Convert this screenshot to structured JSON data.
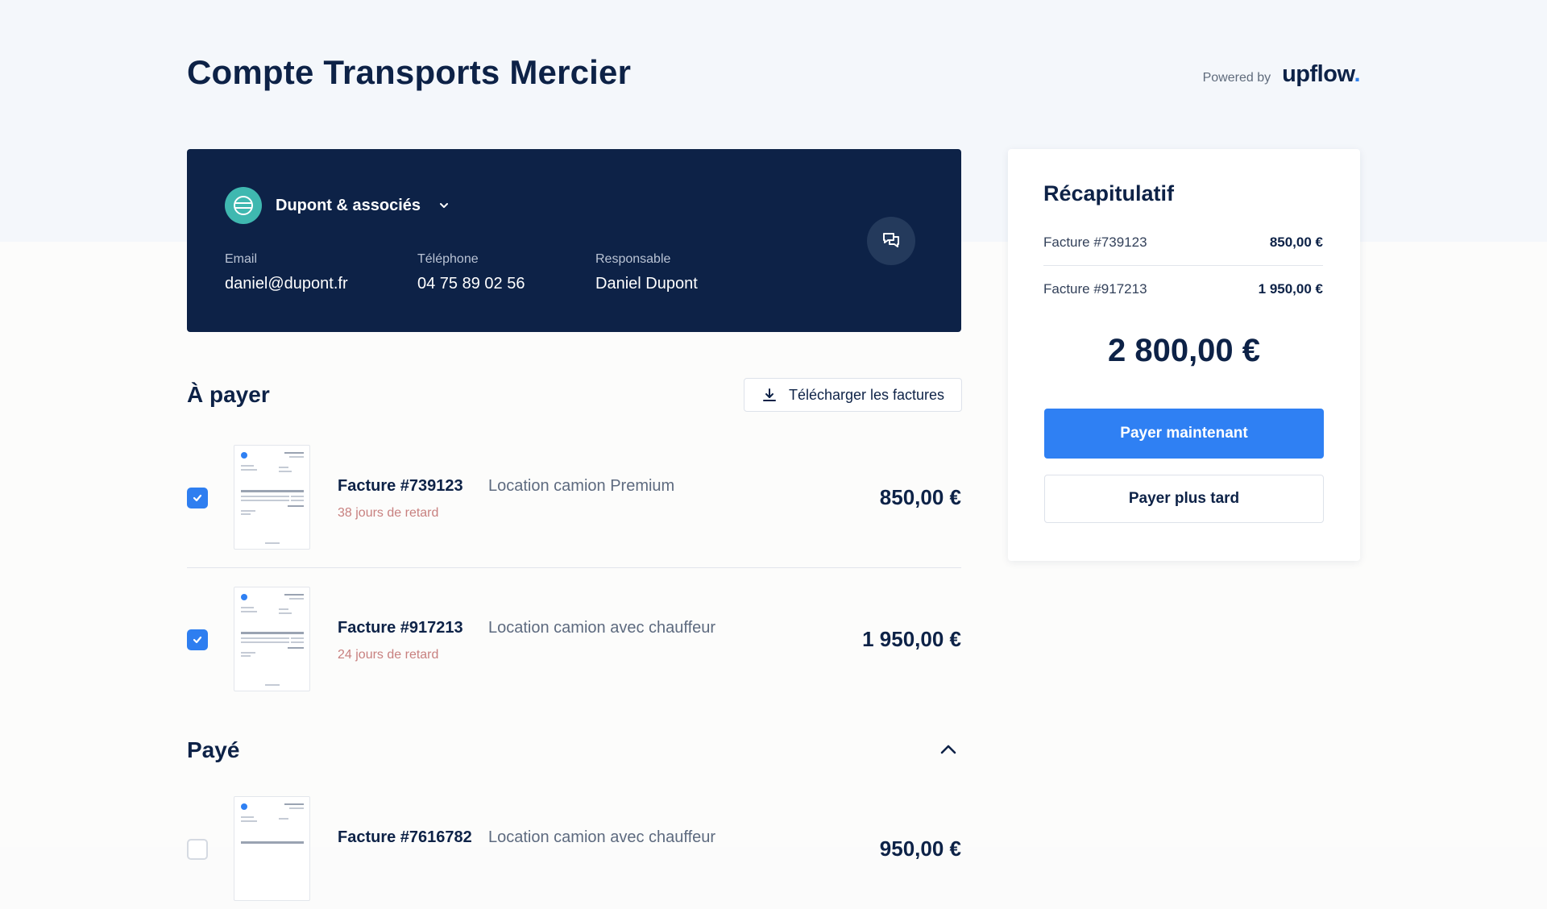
{
  "header": {
    "title": "Compte Transports Mercier",
    "powered_by": "Powered by",
    "brand": "upflow",
    "brand_dot": "."
  },
  "account": {
    "company": "Dupont & associés",
    "contacts": [
      {
        "label": "Email",
        "value": "daniel@dupont.fr"
      },
      {
        "label": "Téléphone",
        "value": "04 75 89 02 56"
      },
      {
        "label": "Responsable",
        "value": "Daniel Dupont"
      }
    ],
    "icons": {
      "company": "globe-icon",
      "chat": "chat-bubbles-icon",
      "dropdown": "chevron-down-icon"
    }
  },
  "to_pay": {
    "title": "À payer",
    "download_label": "Télécharger les factures",
    "invoices": [
      {
        "number": "Facture #739123",
        "description": "Location camion Premium",
        "late": "38 jours de retard",
        "amount": "850,00 €",
        "checked": true
      },
      {
        "number": "Facture #917213",
        "description": "Location camion avec chauffeur",
        "late": "24 jours de retard",
        "amount": "1 950,00 €",
        "checked": true
      }
    ]
  },
  "paid": {
    "title": "Payé",
    "invoices": [
      {
        "number": "Facture #7616782",
        "description": "Location camion avec chauffeur",
        "amount": "950,00 €",
        "checked": false
      }
    ]
  },
  "summary": {
    "title": "Récapitulatif",
    "lines": [
      {
        "label": "Facture #739123",
        "amount": "850,00 €"
      },
      {
        "label": "Facture #917213",
        "amount": "1 950,00 €"
      }
    ],
    "total": "2 800,00 €",
    "pay_now": "Payer maintenant",
    "pay_later": "Payer plus tard"
  },
  "colors": {
    "navy": "#0d2247",
    "accent_blue": "#2f80f3",
    "teal": "#3fb8b0",
    "late_text": "#c8807f"
  }
}
